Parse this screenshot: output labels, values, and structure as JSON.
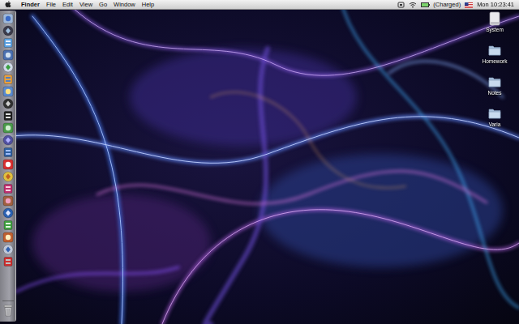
{
  "menu_bar": {
    "items": [
      "Finder",
      "File",
      "Edit",
      "View",
      "Go",
      "Window",
      "Help"
    ],
    "battery": "(Charged)",
    "clock": "Mon 10:23:41"
  },
  "desktop": {
    "icons": [
      {
        "label": "System",
        "kind": "drive"
      },
      {
        "label": "Homework",
        "kind": "folder"
      },
      {
        "label": "Notes",
        "kind": "folder"
      },
      {
        "label": "Varia",
        "kind": "folder"
      }
    ]
  }
}
